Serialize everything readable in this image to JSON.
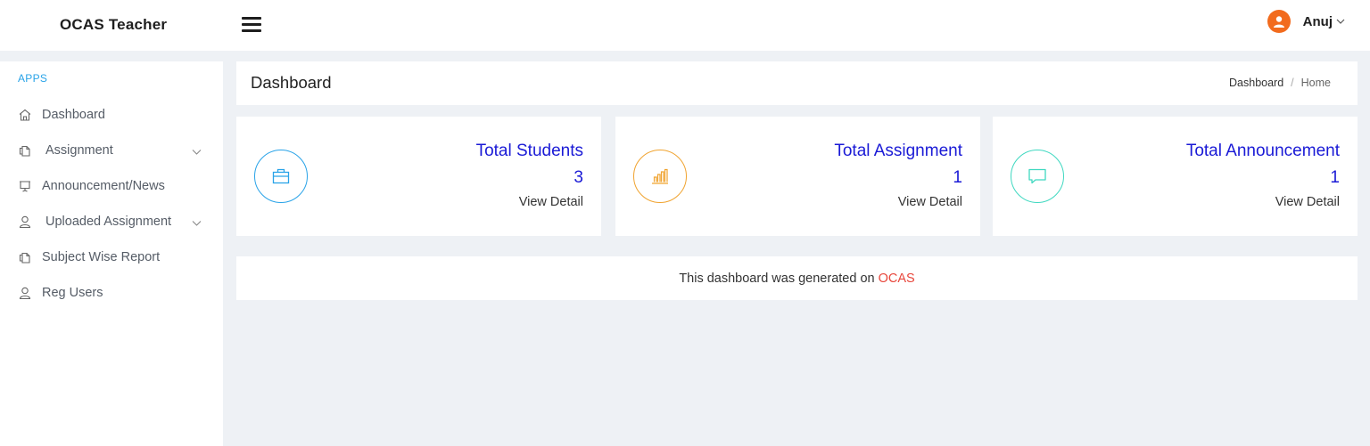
{
  "header": {
    "brand": "OCAS Teacher",
    "user_name": "Anuj"
  },
  "sidebar": {
    "section_label": "APPS",
    "items": [
      {
        "label": "Dashboard",
        "icon": "home-icon",
        "has_children": false
      },
      {
        "label": "Assignment",
        "icon": "copy-icon",
        "has_children": true
      },
      {
        "label": "Announcement/News",
        "icon": "presentation-icon",
        "has_children": false
      },
      {
        "label": "Uploaded Assignment",
        "icon": "user-icon",
        "has_children": true
      },
      {
        "label": "Subject Wise Report",
        "icon": "copy-icon",
        "has_children": false
      },
      {
        "label": "Reg Users",
        "icon": "user-icon",
        "has_children": false
      }
    ]
  },
  "page": {
    "title": "Dashboard",
    "breadcrumb": [
      "Dashboard",
      "Home"
    ]
  },
  "cards": [
    {
      "title": "Total Students",
      "value": "3",
      "link": "View Detail",
      "icon": "briefcase-icon",
      "color": "#29a3e8"
    },
    {
      "title": "Total Assignment",
      "value": "1",
      "link": "View Detail",
      "icon": "bar-chart-icon",
      "color": "#f0a32f"
    },
    {
      "title": "Total Announcement",
      "value": "1",
      "link": "View Detail",
      "icon": "chat-icon",
      "color": "#3fd8c0"
    }
  ],
  "footer": {
    "text": "This dashboard was generated on",
    "link": "OCAS"
  },
  "colors": {
    "accent_blue": "#1a1ad6",
    "apps_label": "#29a3e8",
    "avatar": "#f26b1d",
    "footer_link": "#e8473c"
  }
}
